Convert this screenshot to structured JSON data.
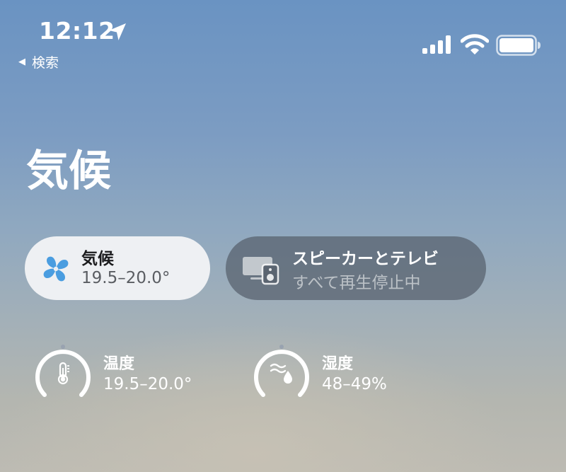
{
  "status_bar": {
    "time": "12:12",
    "back_label": "検索",
    "icons": [
      "location-arrow-icon",
      "cellular-signal-icon",
      "wifi-icon",
      "battery-icon"
    ]
  },
  "page": {
    "title": "気候"
  },
  "tiles": {
    "climate": {
      "title": "気候",
      "subtitle": "19.5–20.0°",
      "icon": "fan-icon",
      "icon_color": "#4a9de0"
    },
    "speakers": {
      "title": "スピーカーとテレビ",
      "subtitle": "すべて再生停止中",
      "icon": "tv-speaker-icon"
    }
  },
  "sensors": {
    "temperature": {
      "label": "温度",
      "value": "19.5–20.0°",
      "icon": "thermometer-icon"
    },
    "humidity": {
      "label": "湿度",
      "value": "48–49%",
      "icon": "humidity-drop-icon"
    }
  }
}
